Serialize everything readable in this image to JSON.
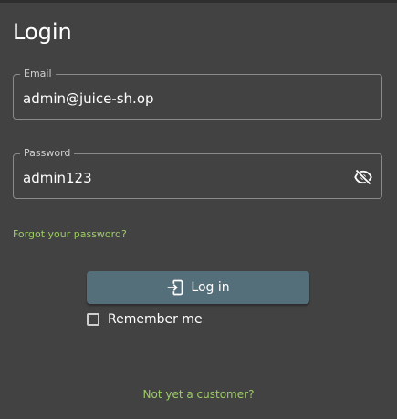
{
  "login": {
    "title": "Login",
    "email": {
      "label": "Email",
      "value": "admin@juice-sh.op"
    },
    "password": {
      "label": "Password",
      "value": "admin123",
      "toggle_icon": "visibility-off-icon"
    },
    "forgot_link": "Forgot your password?",
    "login_button": {
      "label": "Log in",
      "icon": "login-icon"
    },
    "remember_me": {
      "label": "Remember me",
      "checked": false
    },
    "register_link": "Not yet a customer?"
  },
  "colors": {
    "background": "#424242",
    "accent_link": "#9ccc65",
    "button": "#546e7a"
  }
}
